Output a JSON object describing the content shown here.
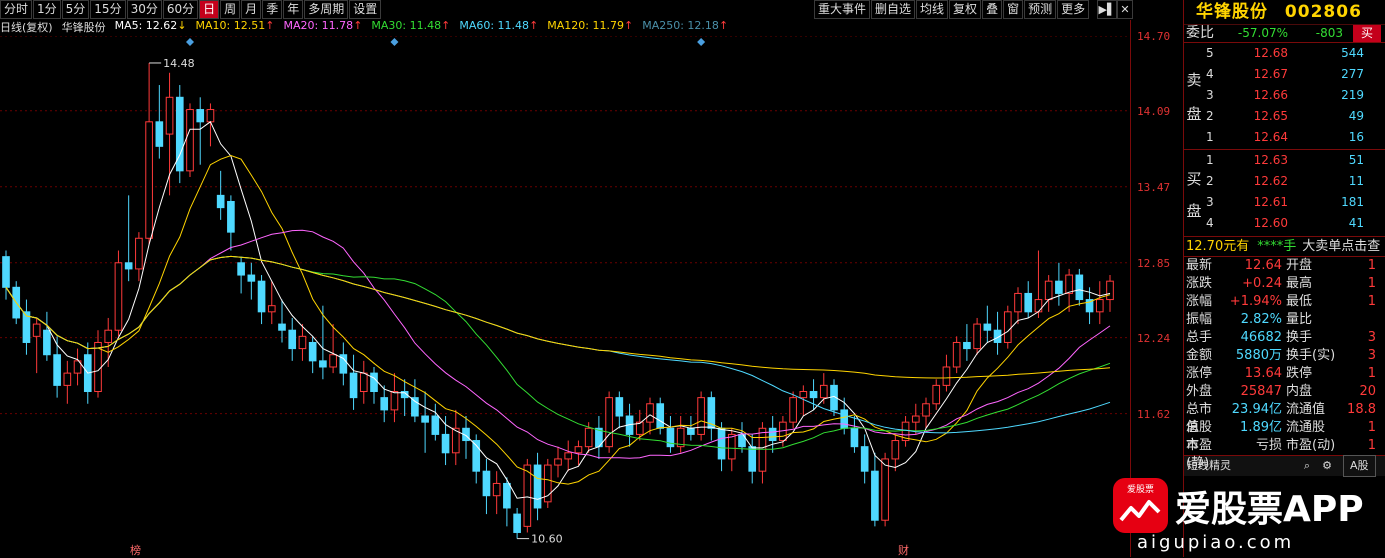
{
  "toolbar": {
    "period_tabs": [
      "分时",
      "1分",
      "5分",
      "15分",
      "30分",
      "60分",
      "日",
      "周",
      "月",
      "季",
      "年",
      "多周期",
      "设置"
    ],
    "active_tab": "日",
    "right_buttons": [
      "重大事件",
      "删自选",
      "均线",
      "复权",
      "叠",
      "窗",
      "预测",
      "更多"
    ]
  },
  "chart_header": {
    "mode": "日线(复权)",
    "name": "华锋股份",
    "ma": [
      {
        "label": "MA5: 12.62",
        "arrow": "↓",
        "color": "#ffffff"
      },
      {
        "label": "MA10: 12.51",
        "arrow": "↑",
        "color": "#ffd400"
      },
      {
        "label": "MA20: 11.78",
        "arrow": "↑",
        "color": "#ff66ff"
      },
      {
        "label": "MA30: 11.48",
        "arrow": "↑",
        "color": "#33dd33"
      },
      {
        "label": "MA60: 11.48",
        "arrow": "↑",
        "color": "#4fd9ff"
      },
      {
        "label": "MA120: 11.79",
        "arrow": "↑",
        "color": "#ffd400"
      },
      {
        "label": "MA250: 12.18",
        "arrow": "↑",
        "color": "#4a8fa8"
      }
    ]
  },
  "price_axis": [
    "14.70",
    "14.09",
    "13.47",
    "12.85",
    "12.24",
    "11.62"
  ],
  "annotations": {
    "high": "14.48",
    "low": "10.60",
    "tag_left": "榜",
    "tag_right": "财"
  },
  "chart_data": {
    "type": "candlestick",
    "ylim": [
      10.45,
      14.7
    ],
    "ohlc": [
      [
        12.9,
        12.95,
        12.55,
        12.65
      ],
      [
        12.65,
        12.7,
        12.35,
        12.4
      ],
      [
        12.45,
        12.55,
        12.1,
        12.2
      ],
      [
        12.25,
        12.4,
        11.95,
        12.35
      ],
      [
        12.3,
        12.45,
        12.05,
        12.1
      ],
      [
        12.1,
        12.25,
        11.75,
        11.85
      ],
      [
        11.85,
        12.05,
        11.7,
        11.95
      ],
      [
        11.95,
        12.15,
        11.85,
        12.05
      ],
      [
        12.1,
        12.2,
        11.7,
        11.8
      ],
      [
        11.8,
        12.3,
        11.75,
        12.2
      ],
      [
        12.2,
        12.4,
        12.0,
        12.3
      ],
      [
        12.3,
        12.95,
        12.25,
        12.85
      ],
      [
        12.85,
        13.4,
        12.7,
        12.8
      ],
      [
        12.8,
        13.1,
        12.7,
        13.05
      ],
      [
        13.05,
        14.48,
        13.0,
        14.0
      ],
      [
        14.0,
        14.3,
        13.7,
        13.8
      ],
      [
        13.9,
        14.4,
        13.4,
        14.2
      ],
      [
        14.2,
        14.3,
        13.5,
        13.6
      ],
      [
        13.6,
        14.15,
        13.55,
        14.1
      ],
      [
        14.1,
        14.2,
        13.65,
        14.0
      ],
      [
        14.0,
        14.15,
        13.8,
        14.1
      ],
      [
        13.4,
        13.6,
        13.2,
        13.3
      ],
      [
        13.35,
        13.4,
        12.95,
        13.1
      ],
      [
        12.85,
        12.9,
        12.6,
        12.75
      ],
      [
        12.75,
        12.85,
        12.55,
        12.7
      ],
      [
        12.7,
        12.75,
        12.35,
        12.45
      ],
      [
        12.45,
        12.7,
        12.35,
        12.5
      ],
      [
        12.35,
        12.55,
        12.2,
        12.3
      ],
      [
        12.3,
        12.4,
        12.05,
        12.15
      ],
      [
        12.15,
        12.35,
        12.05,
        12.25
      ],
      [
        12.2,
        12.25,
        11.95,
        12.05
      ],
      [
        12.05,
        12.5,
        11.9,
        12.0
      ],
      [
        12.0,
        12.35,
        11.95,
        12.1
      ],
      [
        12.1,
        12.2,
        11.85,
        11.95
      ],
      [
        11.95,
        12.1,
        11.65,
        11.75
      ],
      [
        11.8,
        12.05,
        11.7,
        11.95
      ],
      [
        11.95,
        12.0,
        11.7,
        11.8
      ],
      [
        11.75,
        11.85,
        11.55,
        11.65
      ],
      [
        11.65,
        11.95,
        11.55,
        11.8
      ],
      [
        11.8,
        11.9,
        11.6,
        11.75
      ],
      [
        11.75,
        11.9,
        11.55,
        11.6
      ],
      [
        11.6,
        11.8,
        11.3,
        11.55
      ],
      [
        11.6,
        11.7,
        11.4,
        11.45
      ],
      [
        11.45,
        11.6,
        11.2,
        11.3
      ],
      [
        11.3,
        11.65,
        11.2,
        11.5
      ],
      [
        11.5,
        11.6,
        11.25,
        11.4
      ],
      [
        11.4,
        11.45,
        11.05,
        11.15
      ],
      [
        11.15,
        11.25,
        10.8,
        10.95
      ],
      [
        10.95,
        11.15,
        10.8,
        11.05
      ],
      [
        11.05,
        11.1,
        10.7,
        10.85
      ],
      [
        10.8,
        10.85,
        10.6,
        10.65
      ],
      [
        10.7,
        11.25,
        10.65,
        11.2
      ],
      [
        11.2,
        11.3,
        10.75,
        10.85
      ],
      [
        10.9,
        11.25,
        10.85,
        11.2
      ],
      [
        11.2,
        11.35,
        11.1,
        11.25
      ],
      [
        11.25,
        11.4,
        11.15,
        11.3
      ],
      [
        11.3,
        11.4,
        11.2,
        11.35
      ],
      [
        11.35,
        11.55,
        11.3,
        11.5
      ],
      [
        11.5,
        11.6,
        11.25,
        11.35
      ],
      [
        11.35,
        11.8,
        11.3,
        11.75
      ],
      [
        11.75,
        11.8,
        11.5,
        11.6
      ],
      [
        11.6,
        11.7,
        11.35,
        11.45
      ],
      [
        11.45,
        11.65,
        11.4,
        11.55
      ],
      [
        11.55,
        11.75,
        11.45,
        11.7
      ],
      [
        11.7,
        11.75,
        11.45,
        11.5
      ],
      [
        11.5,
        11.6,
        11.3,
        11.35
      ],
      [
        11.35,
        11.6,
        11.3,
        11.5
      ],
      [
        11.5,
        11.6,
        11.4,
        11.45
      ],
      [
        11.45,
        11.8,
        11.4,
        11.75
      ],
      [
        11.75,
        11.8,
        11.4,
        11.5
      ],
      [
        11.5,
        11.55,
        11.15,
        11.25
      ],
      [
        11.25,
        11.5,
        11.15,
        11.45
      ],
      [
        11.45,
        11.55,
        11.3,
        11.35
      ],
      [
        11.35,
        11.45,
        11.05,
        11.15
      ],
      [
        11.15,
        11.55,
        11.05,
        11.5
      ],
      [
        11.5,
        11.6,
        11.3,
        11.4
      ],
      [
        11.4,
        11.6,
        11.35,
        11.55
      ],
      [
        11.55,
        11.8,
        11.5,
        11.75
      ],
      [
        11.75,
        11.85,
        11.6,
        11.8
      ],
      [
        11.8,
        11.9,
        11.65,
        11.75
      ],
      [
        11.75,
        11.95,
        11.7,
        11.85
      ],
      [
        11.85,
        11.9,
        11.6,
        11.65
      ],
      [
        11.65,
        11.75,
        11.45,
        11.5
      ],
      [
        11.5,
        11.6,
        11.3,
        11.35
      ],
      [
        11.35,
        11.45,
        11.05,
        11.15
      ],
      [
        11.15,
        11.3,
        10.7,
        10.75
      ],
      [
        10.75,
        11.3,
        10.7,
        11.25
      ],
      [
        11.25,
        11.45,
        11.15,
        11.4
      ],
      [
        11.4,
        11.6,
        11.35,
        11.55
      ],
      [
        11.55,
        11.7,
        11.45,
        11.6
      ],
      [
        11.6,
        11.75,
        11.5,
        11.7
      ],
      [
        11.7,
        11.9,
        11.65,
        11.85
      ],
      [
        11.85,
        12.1,
        11.8,
        12.0
      ],
      [
        12.0,
        12.25,
        11.95,
        12.2
      ],
      [
        12.2,
        12.35,
        12.05,
        12.15
      ],
      [
        12.15,
        12.4,
        12.1,
        12.35
      ],
      [
        12.35,
        12.5,
        12.2,
        12.3
      ],
      [
        12.3,
        12.45,
        12.1,
        12.2
      ],
      [
        12.2,
        12.5,
        12.15,
        12.45
      ],
      [
        12.45,
        12.65,
        12.35,
        12.6
      ],
      [
        12.6,
        12.7,
        12.4,
        12.45
      ],
      [
        12.45,
        12.95,
        12.4,
        12.55
      ],
      [
        12.55,
        12.75,
        12.45,
        12.7
      ],
      [
        12.7,
        12.85,
        12.5,
        12.6
      ],
      [
        12.6,
        12.8,
        12.45,
        12.75
      ],
      [
        12.75,
        12.8,
        12.5,
        12.55
      ],
      [
        12.55,
        12.65,
        12.35,
        12.45
      ],
      [
        12.45,
        12.7,
        12.35,
        12.55
      ],
      [
        12.55,
        12.75,
        12.45,
        12.7
      ]
    ]
  },
  "panel": {
    "name": "华锋股份",
    "code": "002806",
    "weibi_label": "委比",
    "weibi": "-57.07%",
    "weicha": "-803",
    "buy_btn": "买",
    "sell_side": "卖盘",
    "buy_side": "买盘",
    "asks": [
      {
        "lv": "5",
        "price": "12.68",
        "vol": "544"
      },
      {
        "lv": "4",
        "price": "12.67",
        "vol": "277"
      },
      {
        "lv": "3",
        "price": "12.66",
        "vol": "219"
      },
      {
        "lv": "2",
        "price": "12.65",
        "vol": "49"
      },
      {
        "lv": "1",
        "price": "12.64",
        "vol": "16"
      }
    ],
    "bids": [
      {
        "lv": "1",
        "price": "12.63",
        "vol": "51"
      },
      {
        "lv": "2",
        "price": "12.62",
        "vol": "11"
      },
      {
        "lv": "3",
        "price": "12.61",
        "vol": "181"
      },
      {
        "lv": "4",
        "price": "12.60",
        "vol": "41"
      }
    ],
    "big_sell": {
      "price": "12.70元有",
      "stars": "****手",
      "text": "大卖单点击查"
    },
    "quotes": [
      {
        "l": "最新",
        "v": "12.64",
        "c": "red",
        "l2": "开盘",
        "v2": "1"
      },
      {
        "l": "涨跌",
        "v": "+0.24",
        "c": "red",
        "l2": "最高",
        "v2": "1"
      },
      {
        "l": "涨幅",
        "v": "+1.94%",
        "c": "red",
        "l2": "最低",
        "v2": "1"
      },
      {
        "l": "振幅",
        "v": "2.82%",
        "c": "cyan",
        "l2": "量比",
        "v2": ""
      },
      {
        "l": "总手",
        "v": "46682",
        "c": "cyan",
        "l2": "换手",
        "v2": "3"
      },
      {
        "l": "金额",
        "v": "5880万",
        "c": "cyan",
        "l2": "换手(实)",
        "v2": "3"
      },
      {
        "l": "涨停",
        "v": "13.64",
        "c": "red",
        "l2": "跌停",
        "v2": "1"
      },
      {
        "l": "外盘",
        "v": "25847",
        "c": "red",
        "l2": "内盘",
        "v2": "20"
      },
      {
        "l": "总市值",
        "v": "23.94亿",
        "c": "cyan",
        "l2": "流通值",
        "v2": "18.8"
      },
      {
        "l": "总股本",
        "v": "1.89亿",
        "c": "cyan",
        "l2": "流通股",
        "v2": "1"
      },
      {
        "l": "市盈(静)",
        "v": "亏损",
        "c": "white",
        "l2": "市盈(动)",
        "v2": "1"
      }
    ],
    "short_title": "短线精灵",
    "short_tab": "A股",
    "watermark_text": "爱股票APP",
    "watermark_url": "aigupiao.com",
    "watermark_logo": "爱股票"
  }
}
